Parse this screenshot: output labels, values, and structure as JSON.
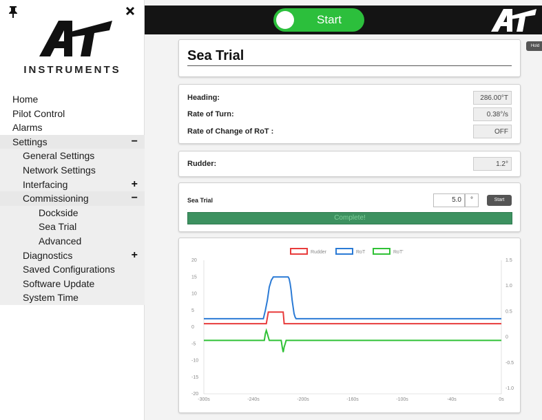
{
  "sidebar": {
    "brand": "INSTRUMENTS",
    "pin_glyph": "📌",
    "close_glyph": "✖",
    "items": [
      {
        "label": "Home",
        "level": 1
      },
      {
        "label": "Pilot Control",
        "level": 1
      },
      {
        "label": "Alarms",
        "level": 1
      },
      {
        "label": "Settings",
        "level": 1,
        "toggle": "−",
        "selected": true
      },
      {
        "label": "General Settings",
        "level": 2
      },
      {
        "label": "Network Settings",
        "level": 2
      },
      {
        "label": "Interfacing",
        "level": 2,
        "toggle": "+"
      },
      {
        "label": "Commissioning",
        "level": 2,
        "toggle": "−",
        "selected": true
      },
      {
        "label": "Dockside",
        "level": 3
      },
      {
        "label": "Sea Trial",
        "level": 3
      },
      {
        "label": "Advanced",
        "level": 3
      },
      {
        "label": "Diagnostics",
        "level": 2,
        "toggle": "+"
      },
      {
        "label": "Saved Configurations",
        "level": 2
      },
      {
        "label": "Software Update",
        "level": 2
      },
      {
        "label": "System Time",
        "level": 2
      }
    ]
  },
  "topbar": {
    "start_label": "Start",
    "hold_label": "Hold"
  },
  "page": {
    "title": "Sea Trial"
  },
  "navigation": {
    "heading_label": "Heading:",
    "heading_value": "286.00°T",
    "rot_label": "Rate of Turn:",
    "rot_value": "0.38°/s",
    "rocrot_label": "Rate of Change of RoT :",
    "rocrot_value": "OFF"
  },
  "rudder": {
    "label": "Rudder:",
    "value": "1.2°"
  },
  "trial": {
    "label": "Sea Trial",
    "input_value": "5.0",
    "unit": "°",
    "start_label": "Start",
    "progress_label": "Complete!",
    "progress": 1.0
  },
  "colors": {
    "rudder": "#e83b3b",
    "rot": "#2a7ad5",
    "rot_dot": "#2fc135",
    "start_green": "#2cbf3c",
    "progress_green": "#3d9160"
  },
  "chart_data": {
    "type": "line",
    "legend": [
      "Rudder",
      "RoT",
      "RoT'"
    ],
    "left_ticks": [
      "20",
      "15",
      "10",
      "5",
      "0",
      "-5",
      "-10",
      "-15",
      "-20"
    ],
    "right_ticks": [
      "1.5",
      "1.0",
      "0.5",
      "0",
      "-0.5",
      "-1.0"
    ],
    "x_ticks": [
      "-300s",
      "-240s",
      "-200s",
      "-160s",
      "-100s",
      "-40s",
      "0s"
    ],
    "ylim_left": [
      -20,
      20
    ],
    "xlim": [
      -300,
      0
    ],
    "series": [
      {
        "name": "Rudder",
        "x": [
          -300,
          -237,
          -235,
          -220,
          -219,
          0
        ],
        "y": [
          1,
          1,
          4.5,
          4.5,
          1,
          1
        ]
      },
      {
        "name": "RoT",
        "x": [
          -300,
          -240,
          -238,
          -236,
          -235,
          -234,
          -233,
          -232,
          -231,
          -230,
          -229,
          -228,
          -215,
          -214,
          -213,
          -212,
          -211,
          -210,
          -209,
          -208,
          -207,
          0
        ],
        "y": [
          2.5,
          2.5,
          5,
          8,
          10,
          12,
          13,
          14,
          14.5,
          15,
          15,
          15,
          15,
          14.5,
          13,
          11,
          8,
          6,
          4,
          3,
          2.5,
          2.5
        ]
      },
      {
        "name": "RoT'",
        "x": [
          -300,
          -239,
          -238,
          -237,
          -236,
          -235,
          -234,
          -222,
          -221,
          -220,
          -219,
          -218,
          -217,
          0
        ],
        "y": [
          -4,
          -4,
          -2,
          -1,
          -2,
          -3,
          -4,
          -4,
          -6,
          -7.5,
          -6,
          -5,
          -4,
          -4
        ]
      }
    ]
  }
}
